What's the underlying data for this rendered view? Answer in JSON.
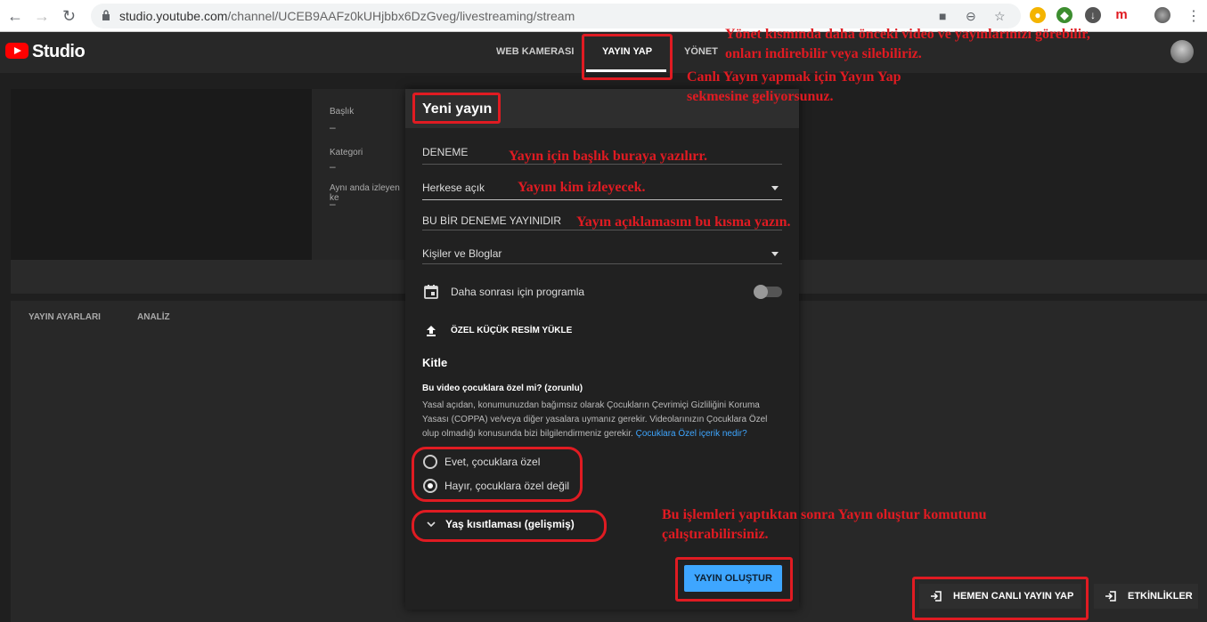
{
  "browser": {
    "url_host": "studio.youtube.com",
    "url_path": "/channel/UCEB9AAFz0kUHjbbx6DzGveg/livestreaming/stream",
    "ext_m": "m"
  },
  "header": {
    "logo_text": "Studio",
    "tabs": [
      {
        "label": "WEB KAMERASI"
      },
      {
        "label": "YAYIN YAP"
      },
      {
        "label": "YÖNET"
      }
    ]
  },
  "info": {
    "title_label": "Başlık",
    "title_value": "–",
    "category_label": "Kategori",
    "category_value": "–",
    "viewers_label": "Aynı anda izleyen ke",
    "viewers_value": "–"
  },
  "lower_tabs": [
    "YAYIN AYARLARI",
    "ANALİZ"
  ],
  "dialog": {
    "title": "Yeni yayın",
    "title_value": "DENEME",
    "visibility_value": "Herkese açık",
    "description_value": "BU BİR DENEME YAYINIDIR",
    "category_value": "Kişiler ve Bloglar",
    "schedule_label": "Daha sonrası için programla",
    "thumbnail_label": "ÖZEL KÜÇÜK RESİM YÜKLE",
    "audience_heading": "Kitle",
    "kids_question": "Bu video çocuklara özel mi? (zorunlu)",
    "kids_desc": "Yasal açıdan, konumunuzdan bağımsız olarak Çocukların Çevrimiçi Gizliliğini Koruma Yasası (COPPA) ve/veya diğer yasalara uymanız gerekir. Videolarınızın Çocuklara Özel olup olmadığı konusunda bizi bilgilendirmeniz gerekir.",
    "kids_link": "Çocuklara Özel içerik nedir?",
    "radio_yes": "Evet, çocuklara özel",
    "radio_no": "Hayır, çocuklara özel değil",
    "age_restriction": "Yaş kısıtlaması (gelişmiş)",
    "create_button": "YAYIN OLUŞTUR"
  },
  "bottom": {
    "go_live_button": "HEMEN CANLI YAYIN YAP",
    "events_button": "ETKİNLİKLER"
  },
  "annotations": {
    "manage_line1": "Yönet kısmında daha önceki video ve yayınlarınızı görebilir,",
    "manage_line2": "onları indirebilir veya silebiliriz.",
    "live_line1": "Canlı Yayın yapmak için Yayın Yap",
    "live_line2": "sekmesine geliyorsunuz.",
    "title_note": "Yayın için başlık buraya yazılırr.",
    "visibility_note": "Yayını kim izleyecek.",
    "desc_note": "Yayın açıklamasını bu kısma yazın.",
    "create_line1": "Bu işlemleri yaptıktan sonra Yayın oluştur komutunu",
    "create_line2": "çalıştırabilirsiniz."
  },
  "colors": {
    "accent": "#3ea6ff",
    "annotation": "#e01b22"
  }
}
